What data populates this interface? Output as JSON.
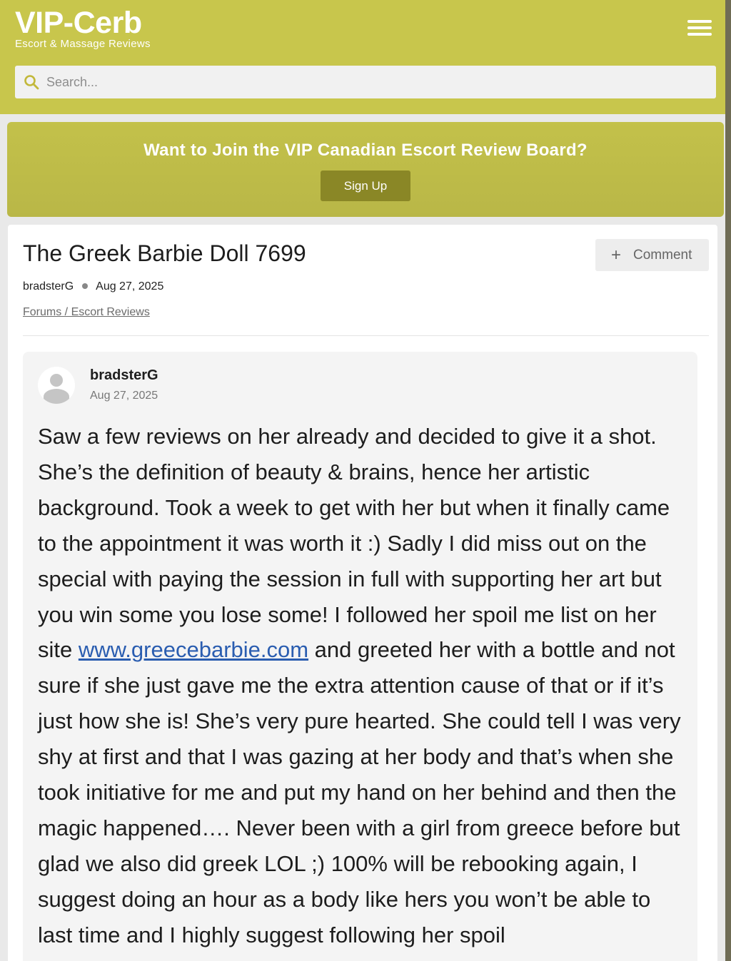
{
  "header": {
    "logo": "VIP-Cerb",
    "tagline": "Escort & Massage Reviews",
    "menu_icon": "hamburger-menu-icon",
    "search_placeholder": "Search..."
  },
  "banner": {
    "text": "Want to Join the VIP Canadian Escort Review Board?",
    "signup_label": "Sign Up"
  },
  "thread": {
    "title": "The Greek Barbie Doll 7699",
    "comment_label": "Comment",
    "author": "bradsterG",
    "date": "Aug 27, 2025",
    "breadcrumb": "Forums / Escort Reviews"
  },
  "post": {
    "author": "bradsterG",
    "date": "Aug 27, 2025",
    "body_before_link": "Saw a few reviews on her already and decided to give it a shot. She’s the definition of beauty & brains, hence her artistic background. Took a week to get with her but when it finally came to the appointment it was worth it :) Sadly I did miss out on the special with paying the session in full with supporting her art but you win some you lose some! I followed her spoil me list on her site ",
    "link_text": "www.greecebarbie.com",
    "body_after_link": " and greeted her with a bottle and not sure if she just gave me the extra attention cause of that or if it’s just how she is! She’s very pure hearted. She could tell I was very shy at first and that I was gazing at her body and that’s when she took initiative for me and put my hand on her behind and then the magic happened…. Never been with a girl from greece before but glad we also did greek LOL ;) 100% will be rebooking again, I suggest doing an hour as a body like hers you won’t be able to last time and I highly suggest following her spoil"
  },
  "colors": {
    "header_bg": "#c8c64c",
    "banner_bg": "#bdbb48",
    "signup_bg": "#8a8726",
    "link": "#2a5db0"
  }
}
